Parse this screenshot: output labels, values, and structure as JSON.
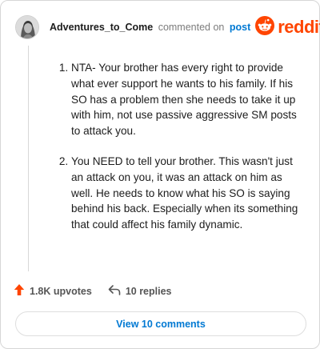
{
  "header": {
    "username": "Adventures_to_Come",
    "commented_on": "commented on",
    "post_link": "post",
    "brand": "reddit",
    "brand_color": "#ff4500",
    "avatar_icon": "user-avatar-image",
    "brand_icon": "reddit-snoo-icon"
  },
  "comment": {
    "items": [
      "NTA- Your brother has every right to provide what ever support he wants to his family. If his SO has a problem then she needs to take it up with him, not use passive aggressive SM posts to attack you.",
      "You NEED to tell your brother. This wasn't just an attack on you, it was an attack on him as well. He needs to know what his SO is saying behind his back. Especially when its something that could affect his family dynamic."
    ]
  },
  "actions": {
    "upvotes_label": "1.8K upvotes",
    "replies_label": "10 replies",
    "upvote_icon": "upvote-arrow-icon",
    "reply_icon": "reply-arrow-icon",
    "upvote_color": "#ff4500"
  },
  "view_comments_label": "View 10 comments",
  "accent_color": "#0079d3"
}
